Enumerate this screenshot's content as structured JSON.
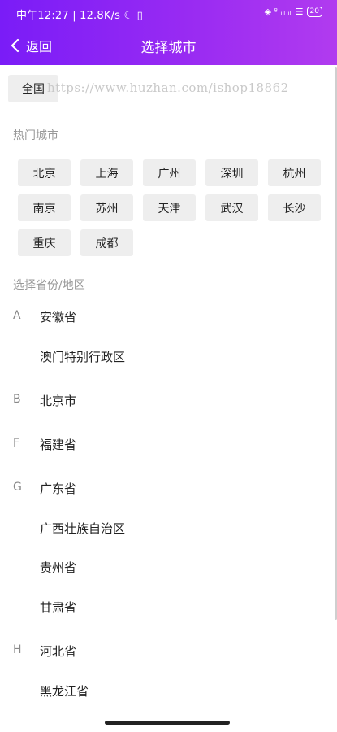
{
  "status_bar": {
    "left_text": "中午12:27 | 12.8K/s ☾ ▯",
    "right_text": "◈ ⁸ ᵢₗₗ ᵢₗₗ ☰",
    "battery": "20"
  },
  "nav": {
    "back_label": "返回",
    "title": "选择城市"
  },
  "all_button": "全国",
  "watermark": "https://www.huzhan.com/ishop18862",
  "hot_section_title": "热门城市",
  "hot_cities": [
    "北京",
    "上海",
    "广州",
    "深圳",
    "杭州",
    "南京",
    "苏州",
    "天津",
    "武汉",
    "长沙",
    "重庆",
    "成都"
  ],
  "province_section_title": "选择省份/地区",
  "provinces": [
    {
      "letter": "A",
      "name": "安徽省"
    },
    {
      "letter": "",
      "name": "澳门特别行政区"
    },
    {
      "letter": "B",
      "name": "北京市"
    },
    {
      "letter": "F",
      "name": "福建省"
    },
    {
      "letter": "G",
      "name": "广东省"
    },
    {
      "letter": "",
      "name": "广西壮族自治区"
    },
    {
      "letter": "",
      "name": "贵州省"
    },
    {
      "letter": "",
      "name": "甘肃省"
    },
    {
      "letter": "H",
      "name": "河北省"
    },
    {
      "letter": "",
      "name": "黑龙江省"
    }
  ],
  "colors": {
    "header_start": "#7a1cf7",
    "header_end": "#b13bef",
    "chip_bg": "#eeeeee"
  }
}
